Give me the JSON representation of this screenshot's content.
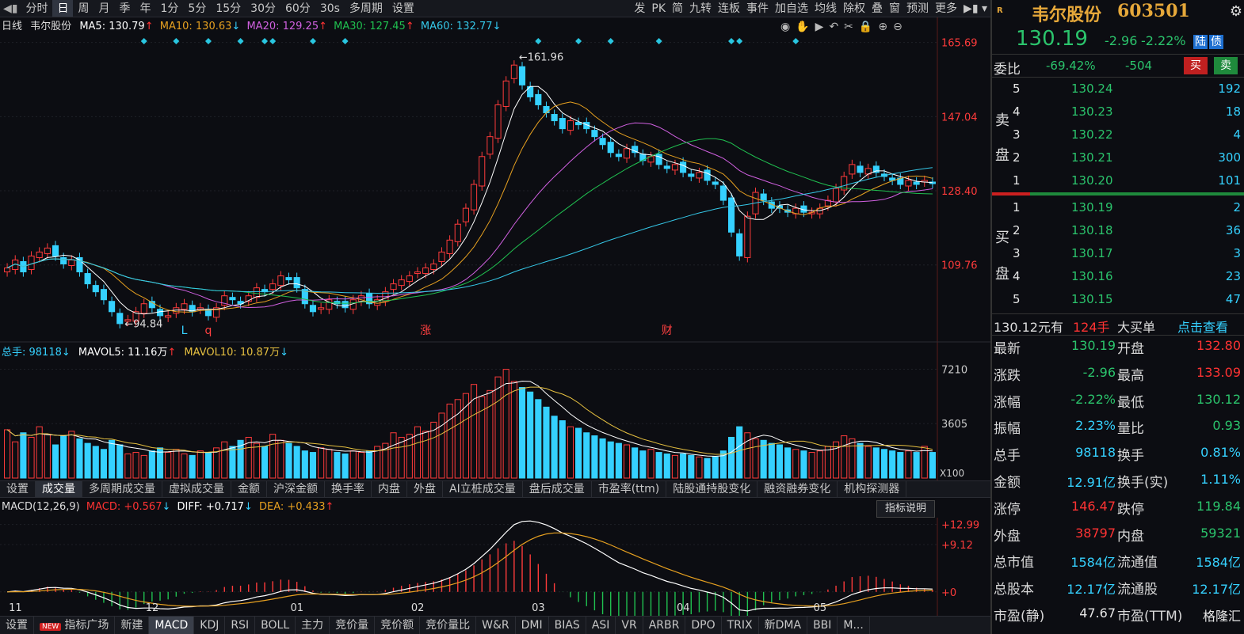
{
  "topbar": {
    "tabs": [
      "分时",
      "日",
      "周",
      "月",
      "季",
      "年",
      "1分",
      "5分",
      "15分",
      "30分",
      "60分",
      "30s",
      "多周期",
      "设置"
    ],
    "active": "日",
    "right": [
      "发",
      "PK",
      "简",
      "九转",
      "连板",
      "事件",
      "加自选",
      "均线",
      "除权",
      "叠",
      "窗",
      "预测",
      "更多"
    ]
  },
  "legend_main": {
    "period": "日线",
    "name": "韦尔股份",
    "ma5": "MA5: 130.79",
    "ma10": "MA10: 130.63",
    "ma20": "MA20: 129.25",
    "ma30": "MA30: 127.45",
    "ma60": "MA60: 132.77"
  },
  "legend_vol": {
    "total": "总手: 98118",
    "mavol5": "MAVOL5: 11.16万",
    "mavol10": "MAVOL10: 10.87万"
  },
  "legend_macd": {
    "title": "MACD(12,26,9)",
    "macd": "MACD: +0.567",
    "diff": "DIFF: +0.717",
    "dea": "DEA: +0.433",
    "help": "指标说明"
  },
  "subtabs": [
    "设置",
    "成交量",
    "多周期成交量",
    "虚拟成交量",
    "金额",
    "沪深金额",
    "换手率",
    "内盘",
    "外盘",
    "AI立桩成交量",
    "盘后成交量",
    "市盈率(ttm)",
    "陆股通持股变化",
    "融资融券变化",
    "机构探测器"
  ],
  "subtabs_active": "成交量",
  "bottombar": [
    "设置",
    "指标广场",
    "新建",
    "MACD",
    "KDJ",
    "RSI",
    "BOLL",
    "主力",
    "竞价量",
    "竞价额",
    "竞价量比",
    "W&R",
    "DMI",
    "BIAS",
    "ASI",
    "VR",
    "ARBR",
    "DPO",
    "TRIX",
    "新DMA",
    "BBI",
    "M..."
  ],
  "bottombar_active": "MACD",
  "bottombar_badge": "NEW",
  "chart_data": [
    {
      "type": "candlestick",
      "title": "日线",
      "y_ticks": [
        "165.69",
        "147.04",
        "128.40",
        "109.76"
      ],
      "ylim": [
        90,
        168
      ],
      "x_labels": [
        "11",
        "12",
        "01",
        "02",
        "03",
        "04",
        "05"
      ],
      "annotations": [
        "161.96",
        "94.84",
        "L",
        "q",
        "涨",
        "财"
      ],
      "series": [
        {
          "name": "MA5",
          "color": "#ffffff"
        },
        {
          "name": "MA10",
          "color": "#e6a020"
        },
        {
          "name": "MA20",
          "color": "#d060e0"
        },
        {
          "name": "MA30",
          "color": "#20c050"
        },
        {
          "name": "MA60",
          "color": "#35c8e8"
        }
      ],
      "close": [
        109,
        111,
        108,
        112,
        113,
        114,
        112,
        110,
        111,
        108,
        105,
        103,
        101,
        98,
        95,
        96,
        98,
        100,
        99,
        97,
        97,
        99,
        100,
        98,
        99,
        97,
        99,
        102,
        101,
        100,
        102,
        104,
        103,
        105,
        107,
        106,
        104,
        100,
        98,
        99,
        101,
        100,
        99,
        101,
        102,
        100,
        101,
        103,
        105,
        106,
        107,
        108,
        109,
        110,
        113,
        116,
        120,
        124,
        130,
        137,
        142,
        150,
        156,
        160,
        155,
        152,
        150,
        148,
        146,
        144,
        146,
        145,
        144,
        142,
        140,
        138,
        137,
        139,
        138,
        136,
        137,
        135,
        134,
        135,
        133,
        132,
        133,
        131,
        130,
        126,
        118,
        112,
        122,
        128,
        126,
        124,
        124,
        123,
        124,
        123,
        123,
        124,
        126,
        129,
        132,
        135,
        133,
        134,
        133,
        132,
        131,
        130,
        131,
        130,
        131,
        130.19
      ]
    },
    {
      "type": "bar",
      "title": "成交量",
      "y_ticks": [
        "7210",
        "3605",
        "X100"
      ],
      "ylim": [
        0,
        7600
      ],
      "series": [
        {
          "name": "MAVOL5",
          "color": "#ffffff"
        },
        {
          "name": "MAVOL10",
          "color": "#e6c040"
        }
      ],
      "values": [
        3200,
        2400,
        3000,
        2700,
        3400,
        2900,
        2200,
        2800,
        3100,
        2600,
        2300,
        2100,
        1900,
        2500,
        2200,
        1600,
        1700,
        1500,
        1800,
        2000,
        1700,
        1900,
        1600,
        1500,
        1800,
        1700,
        2000,
        2400,
        2100,
        2500,
        2700,
        2300,
        2100,
        2900,
        2500,
        2300,
        2100,
        1800,
        1700,
        2000,
        1900,
        1700,
        1600,
        1800,
        1700,
        1800,
        2100,
        2300,
        3000,
        2700,
        2900,
        3400,
        3100,
        3700,
        4300,
        4900,
        5200,
        5600,
        6200,
        5400,
        5800,
        6700,
        7200,
        6400,
        6000,
        5700,
        5200,
        4700,
        4100,
        3800,
        3400,
        3300,
        3000,
        2800,
        2600,
        2400,
        2300,
        2200,
        2000,
        1800,
        1900,
        1700,
        1600,
        1500,
        1600,
        1500,
        1400,
        1300,
        1400,
        1800,
        2700,
        3400,
        3000,
        2600,
        2500,
        2300,
        2200,
        2000,
        1900,
        1800,
        1700,
        1800,
        2100,
        2400,
        2800,
        2600,
        2300,
        2100,
        2000,
        1900,
        1800,
        1700,
        1800,
        1700,
        2100,
        1700
      ]
    },
    {
      "type": "bar",
      "title": "MACD(12,26,9)",
      "y_ticks": [
        "+12.99",
        "+9.12",
        "+0"
      ],
      "ylim": [
        -4,
        14
      ],
      "series": [
        {
          "name": "DIFF",
          "color": "#ffffff"
        },
        {
          "name": "DEA",
          "color": "#e6a020"
        }
      ]
    }
  ],
  "right": {
    "name": "韦尔股份",
    "code": "603501",
    "price": "130.19",
    "change": "-2.96",
    "pct": "-2.22%",
    "badge1": "陆",
    "badge2": "债",
    "weibi_label": "委比",
    "weibi": "-69.42%",
    "weicha": "-504",
    "buy_btn": "买",
    "sell_btn": "卖",
    "sell_label": [
      "卖",
      "盘"
    ],
    "buy_label": [
      "买",
      "盘"
    ],
    "asks": [
      {
        "lv": "5",
        "p": "130.24",
        "v": "192"
      },
      {
        "lv": "4",
        "p": "130.23",
        "v": "18"
      },
      {
        "lv": "3",
        "p": "130.22",
        "v": "4"
      },
      {
        "lv": "2",
        "p": "130.21",
        "v": "300"
      },
      {
        "lv": "1",
        "p": "130.20",
        "v": "101"
      }
    ],
    "bids": [
      {
        "lv": "1",
        "p": "130.19",
        "v": "2"
      },
      {
        "lv": "2",
        "p": "130.18",
        "v": "36"
      },
      {
        "lv": "3",
        "p": "130.17",
        "v": "3"
      },
      {
        "lv": "4",
        "p": "130.16",
        "v": "23"
      },
      {
        "lv": "5",
        "p": "130.15",
        "v": "47"
      }
    ],
    "tick_price": "130.12元有",
    "tick_vol": "124手",
    "big_order": "大买单",
    "click_view": "点击查看",
    "quotes": [
      [
        "最新",
        "130.19",
        "开盘",
        "132.80"
      ],
      [
        "涨跌",
        "-2.96",
        "最高",
        "133.09"
      ],
      [
        "涨幅",
        "-2.22%",
        "最低",
        "130.12"
      ],
      [
        "振幅",
        "2.23%",
        "量比",
        "0.93"
      ],
      [
        "总手",
        "98118",
        "换手",
        "0.81%"
      ],
      [
        "金额",
        "12.91亿",
        "换手(实)",
        "1.11%"
      ],
      [
        "涨停",
        "146.47",
        "跌停",
        "119.84"
      ],
      [
        "外盘",
        "38797",
        "内盘",
        "59321"
      ],
      [
        "总市值",
        "1584亿",
        "流通值",
        "1584亿"
      ],
      [
        "总股本",
        "12.17亿",
        "流通股",
        "12.17亿"
      ],
      [
        "市盈(静)",
        "47.67",
        "市盈(TTM)",
        "格隆汇"
      ]
    ]
  }
}
